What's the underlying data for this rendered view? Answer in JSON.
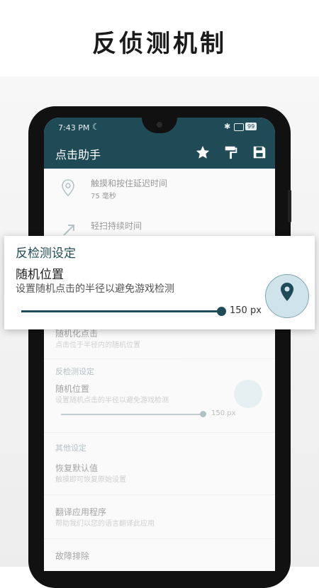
{
  "hero": {
    "title": "反侦测机制"
  },
  "status_bar": {
    "time": "7:43 PM",
    "battery": "99"
  },
  "app_bar": {
    "title": "点击助手",
    "icons": [
      "star-icon",
      "paint-roller-icon",
      "save-icon"
    ]
  },
  "list": {
    "items": [
      {
        "title": "触摸和按住延迟时间",
        "subtitle": "75 毫秒",
        "icon": "location-pin-icon"
      },
      {
        "title": "轻扫持续时间",
        "subtitle": "",
        "icon": "swipe-arrow-icon"
      },
      {
        "title": "随机化点击",
        "subtitle": "点击位于半径内的随机位置"
      }
    ],
    "anti_detect_section": "反检测设定",
    "random_position": {
      "title": "随机位置",
      "subtitle": "设置随机点击的半径以避免游戏检测",
      "value": "150 px"
    },
    "other_section": "其他设定",
    "restore": {
      "title": "恢复默认值",
      "subtitle": "触摸即可恢复原始设置"
    },
    "translate": {
      "title": "翻译应用程序",
      "subtitle": "帮助我们以您的语言翻译此应用"
    },
    "troubleshoot": {
      "title": "故障排除",
      "subtitle": ""
    }
  },
  "card": {
    "section": "反检测设定",
    "title": "随机位置",
    "subtitle": "设置随机点击的半径以避免游戏检测",
    "slider_value": "150 px",
    "slider_fraction": 1.0,
    "icon": "location-pin-icon"
  },
  "colors": {
    "primary": "#1f4b57",
    "accent_light": "#cfe3ea"
  }
}
